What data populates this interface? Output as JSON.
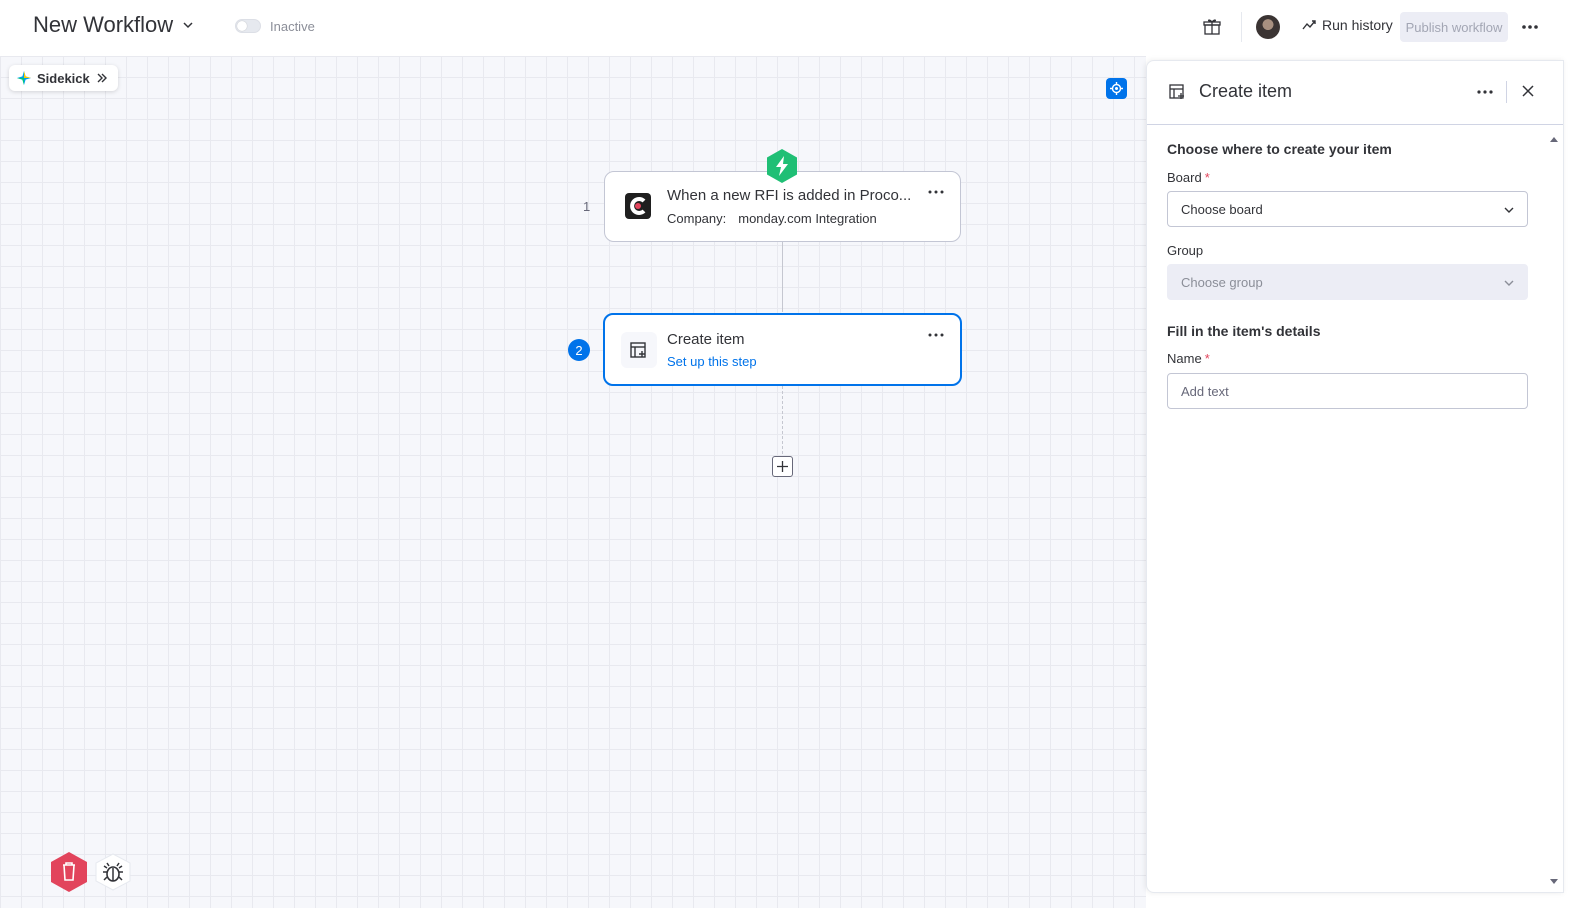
{
  "header": {
    "workflow_title": "New Workflow",
    "status_label": "Inactive",
    "run_history_label": "Run history",
    "publish_label": "Publish workflow"
  },
  "canvas": {
    "sidekick_label": "Sidekick",
    "steps": [
      {
        "number": "1",
        "title": "When a new RFI is added in Proco...",
        "sub_key": "Company:",
        "sub_value": "monday.com Integration"
      },
      {
        "number": "2",
        "title": "Create item",
        "link": "Set up this step"
      }
    ]
  },
  "panel": {
    "title": "Create item",
    "section1_title": "Choose where to create your item",
    "board_label": "Board",
    "board_placeholder": "Choose board",
    "group_label": "Group",
    "group_placeholder": "Choose group",
    "section2_title": "Fill in the item's details",
    "name_label": "Name",
    "name_placeholder": "Add text",
    "required_mark": "*"
  },
  "colors": {
    "accent": "#0073ea",
    "trigger_green": "#1fbf75",
    "danger": "#e2445c"
  }
}
